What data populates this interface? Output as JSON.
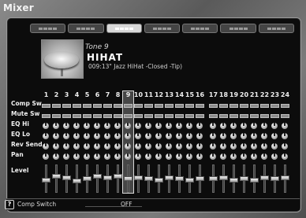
{
  "app": {
    "title": "Mixer"
  },
  "pages": {
    "count": 7,
    "active_index": 2
  },
  "tone": {
    "label": "Tone 9",
    "name": "HIHAT",
    "description": "009:13\" Jazz HiHat -Closed -Tip)"
  },
  "rows": [
    "Comp Sw",
    "Mute Sw",
    "EQ Hi",
    "EQ Lo",
    "Rev Send",
    "Pan",
    "Level"
  ],
  "channels": {
    "numbers": [
      "1",
      "2",
      "3",
      "4",
      "5",
      "6",
      "7",
      "8",
      "9",
      "10",
      "11",
      "12",
      "13",
      "14",
      "15",
      "16",
      "17",
      "18",
      "19",
      "20",
      "21",
      "22",
      "23",
      "24"
    ],
    "selected": "9",
    "levels": [
      0.45,
      0.6,
      0.55,
      0.4,
      0.5,
      0.6,
      0.55,
      0.6,
      0.5,
      0.55,
      0.5,
      0.45,
      0.55,
      0.5,
      0.45,
      0.5,
      0.5,
      0.55,
      0.45,
      0.5,
      0.45,
      0.55,
      0.5,
      0.55
    ]
  },
  "status": {
    "label": "Comp Switch",
    "value": "OFF"
  }
}
